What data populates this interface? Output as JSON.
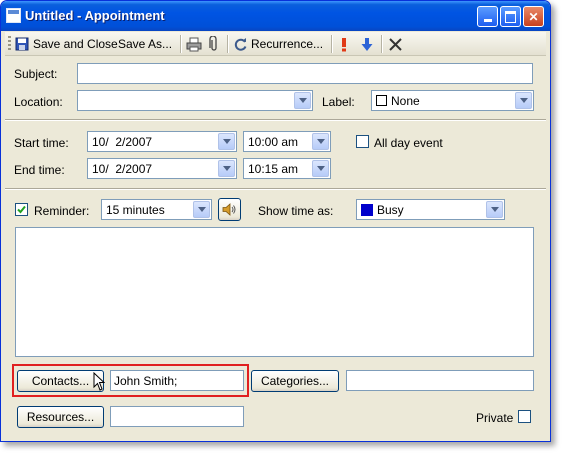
{
  "window": {
    "title": "Untitled - Appointment"
  },
  "toolbar": {
    "save_close": "Save and Close",
    "save_as": "Save As...",
    "recurrence": "Recurrence..."
  },
  "form": {
    "subject_label": "Subject:",
    "location_label": "Location:",
    "label_label": "Label:",
    "label_value": "None",
    "start_label": "Start time:",
    "start_date": "10/  2/2007",
    "start_time": "10:00 am",
    "end_label": "End time:",
    "end_date": "10/  2/2007",
    "end_time": "10:15 am",
    "all_day": "All day event",
    "reminder_label": "Reminder:",
    "reminder_value": "15 minutes",
    "show_time_label": "Show time as:",
    "show_time_value": "Busy",
    "contacts_button": "Contacts...",
    "contacts_value": "John Smith;",
    "categories_button": "Categories...",
    "resources_button": "Resources...",
    "private_label": "Private"
  },
  "colors": {
    "highlight": "#e02020",
    "busy": "#0000cc",
    "none": "#ffffff"
  },
  "state": {
    "reminder_checked": true,
    "all_day_checked": false,
    "private_checked": false
  }
}
